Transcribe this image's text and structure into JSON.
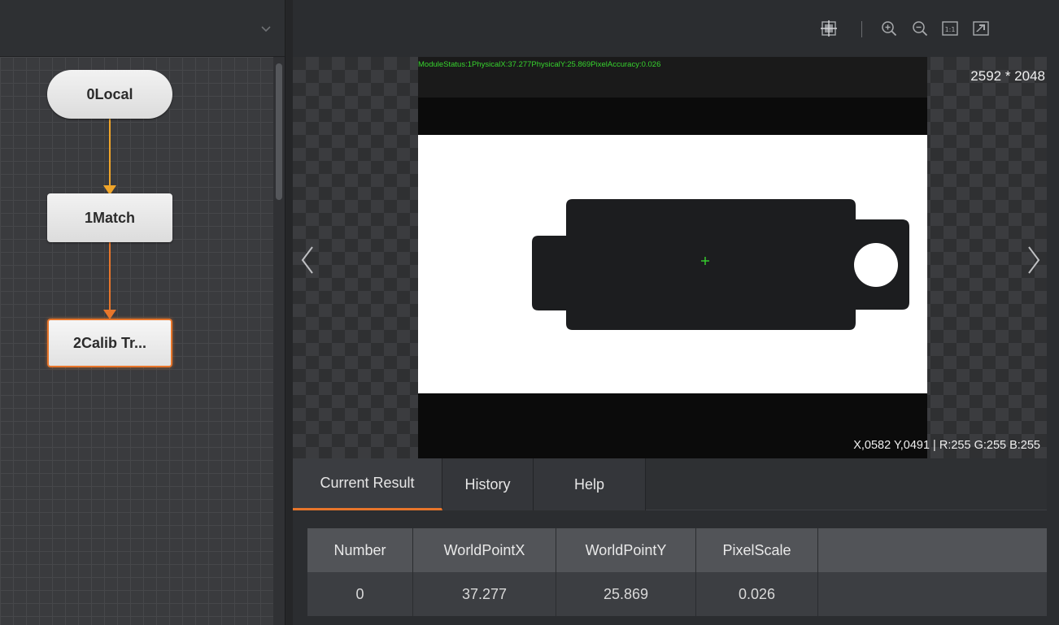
{
  "flow": {
    "nodes": [
      {
        "label": "0Local"
      },
      {
        "label": "1Match"
      },
      {
        "label": "2Calib Tr..."
      }
    ]
  },
  "toolbar": {
    "icons": [
      "crosshair-grid-icon",
      "zoom-in-icon",
      "zoom-out-icon",
      "actual-size-icon",
      "fit-window-icon"
    ],
    "actual_size_label": "1:1"
  },
  "viewer": {
    "status_text": "ModuleStatus:1PhysicalX:37.277PhysicalY:25.869PixelAccuracy:0.026",
    "image_size": "2592 * 2048",
    "pixel_info": "X,0582  Y,0491  |  R:255  G:255  B:255"
  },
  "result": {
    "tabs": [
      {
        "label": "Current Result",
        "active": true
      },
      {
        "label": "History",
        "active": false
      },
      {
        "label": "Help",
        "active": false
      }
    ],
    "table": {
      "headers": [
        "Number",
        "WorldPointX",
        "WorldPointY",
        "PixelScale"
      ],
      "rows": [
        [
          "0",
          "37.277",
          "25.869",
          "0.026"
        ]
      ]
    }
  },
  "colors": {
    "accent": "#e8762b",
    "connector_yellow": "#f0a52a",
    "status_green": "#37d42e"
  }
}
